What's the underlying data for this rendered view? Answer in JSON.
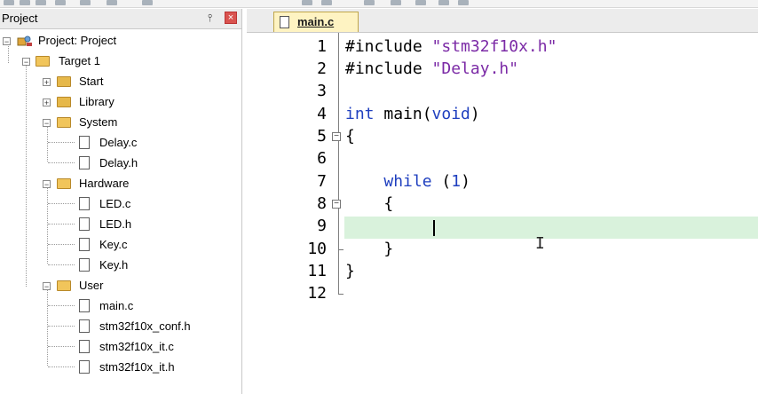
{
  "project_panel": {
    "title": "Project",
    "pin_glyph": "⫯",
    "close_glyph": "×",
    "tree": {
      "root": "Project: Project",
      "target": "Target 1",
      "groups": {
        "start": "Start",
        "library": "Library",
        "system": {
          "name": "System",
          "files": [
            "Delay.c",
            "Delay.h"
          ]
        },
        "hardware": {
          "name": "Hardware",
          "files": [
            "LED.c",
            "LED.h",
            "Key.c",
            "Key.h"
          ]
        },
        "user": {
          "name": "User",
          "files": [
            "main.c",
            "stm32f10x_conf.h",
            "stm32f10x_it.c",
            "stm32f10x_it.h"
          ]
        }
      }
    }
  },
  "editor": {
    "active_tab": "main.c",
    "line_numbers": [
      "1",
      "2",
      "3",
      "4",
      "5",
      "6",
      "7",
      "8",
      "9",
      "10",
      "11",
      "12"
    ],
    "code": {
      "l1_directive": "#include",
      "l1_string": "\"stm32f10x.h\"",
      "l2_directive": "#include",
      "l2_string": "\"Delay.h\"",
      "l4_type": "int",
      "l4_name": "main(",
      "l4_param": "void",
      "l4_close": ")",
      "l5": "{",
      "l7_keyword": "while",
      "l7_open": "(",
      "l7_num": "1",
      "l7_close": ")",
      "l8": "{",
      "l10": "}",
      "l11": "}"
    },
    "fold_glyph": "−",
    "highlight_color": "#d9f2dc",
    "keyword_color": "#1f3fbf",
    "string_color": "#7b2aa6"
  },
  "mouse_cursor": "I"
}
